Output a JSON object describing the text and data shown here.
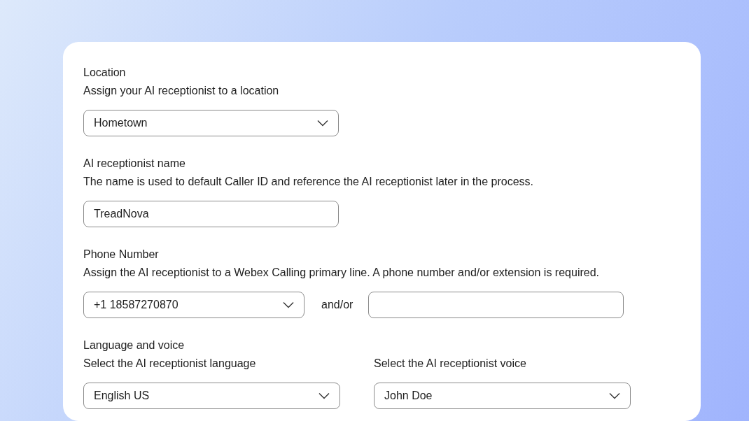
{
  "sections": [
    {
      "label": "Location",
      "description": "Assign your AI receptionist to a location",
      "controls": [
        {
          "kind": "select",
          "value": "Hometown"
        }
      ]
    },
    {
      "label": "AI receptionist name",
      "description": "The name is used to default Caller ID and reference the AI receptionist later in the process.",
      "controls": [
        {
          "kind": "input",
          "value": "TreadNova"
        }
      ]
    },
    {
      "label": "Phone Number",
      "description": "Assign the AI receptionist to a Webex Calling primary line. A phone number and/or extension is required.",
      "controls": [
        {
          "kind": "select",
          "value": "+1 18587270870"
        },
        {
          "kind": "separator",
          "text": "and/or"
        },
        {
          "kind": "input"
        }
      ]
    },
    {
      "label": "Language and voice",
      "controls": [
        {
          "kind": "select",
          "caption": "Select the AI receptionist language",
          "value": "English US"
        },
        {
          "kind": "select",
          "caption": "Select the AI receptionist voice",
          "value": "John Doe"
        }
      ]
    }
  ]
}
